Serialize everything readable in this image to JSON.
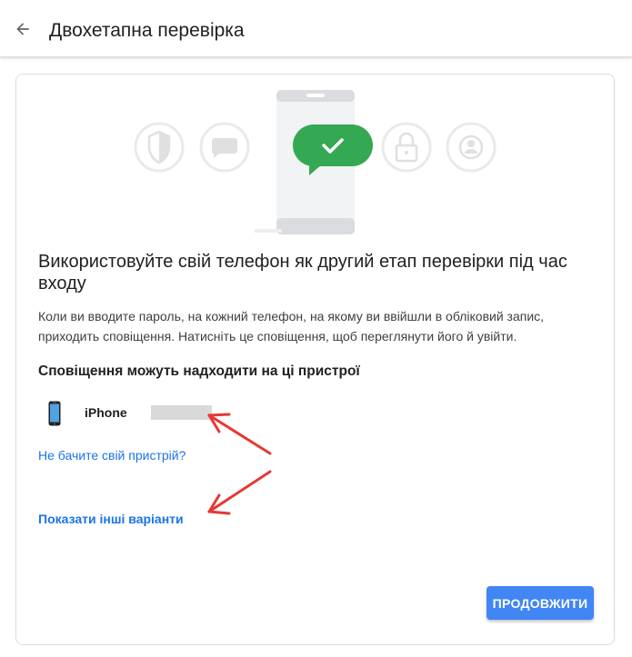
{
  "header": {
    "title": "Двохетапна перевірка",
    "back_icon": "arrow-back-icon"
  },
  "illustration": {
    "icons": [
      "shield-icon",
      "chat-bubble-icon",
      "phone-check-icon",
      "lock-icon",
      "account-icon"
    ],
    "check_color": "#34a853"
  },
  "main": {
    "headline": "Використовуйте свій телефон як другий етап перевірки під час входу",
    "description": "Коли ви вводите пароль, на кожний телефон, на якому ви ввійшли в обліковий запис, приходить сповіщення. Натисніть це сповіщення, щоб переглянути його й увійти.",
    "devices_title": "Сповіщення можуть надходити на ці пристрої",
    "devices": [
      {
        "name": "iPhone",
        "icon": "iphone-icon"
      }
    ],
    "cant_see_link": "Не бачите свій пристрій?",
    "more_options_link": "Показати інші варіанти",
    "continue_label": "ПРОДОВЖИТИ"
  },
  "colors": {
    "accent": "#1a73e8",
    "button": "#4285f4",
    "annotation": "#e53935"
  }
}
